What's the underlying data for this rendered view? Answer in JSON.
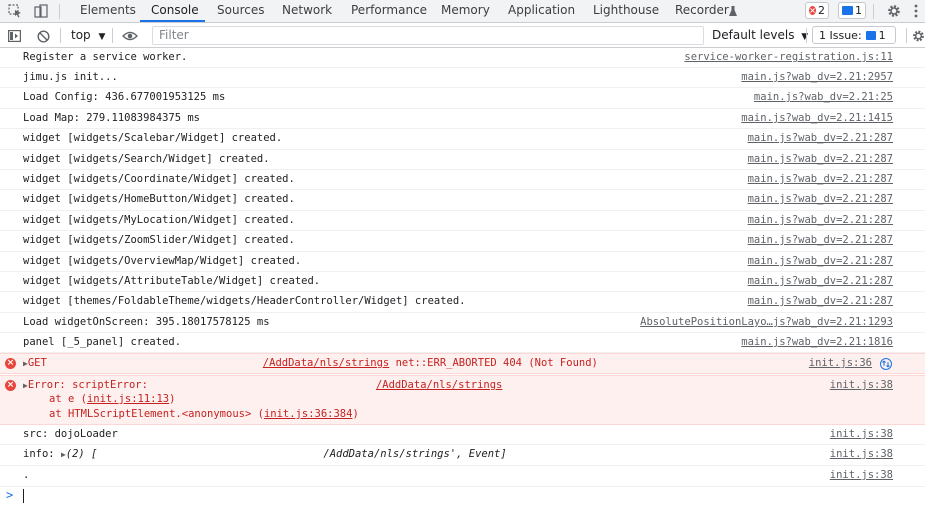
{
  "tabs": [
    {
      "label": "Elements"
    },
    {
      "label": "Console"
    },
    {
      "label": "Sources"
    },
    {
      "label": "Network"
    },
    {
      "label": "Performance"
    },
    {
      "label": "Memory"
    },
    {
      "label": "Application"
    },
    {
      "label": "Lighthouse"
    },
    {
      "label": "Recorder"
    }
  ],
  "badges": {
    "errors": "2",
    "messages": "1"
  },
  "toolbar": {
    "context": "top",
    "filter_placeholder": "Filter",
    "levels": "Default levels",
    "issues": "1 Issue:",
    "issues_count": "1"
  },
  "rows": [
    {
      "msg": "Register a service worker.",
      "src": "service-worker-registration.js:11"
    },
    {
      "msg": "jimu.js init...",
      "src": "main.js?wab_dv=2.21:2957"
    },
    {
      "msg": "Load Config: 436.677001953125 ms",
      "src": "main.js?wab_dv=2.21:25"
    },
    {
      "msg": "Load Map: 279.11083984375 ms",
      "src": "main.js?wab_dv=2.21:1415"
    },
    {
      "msg": "widget [widgets/Scalebar/Widget] created.",
      "src": "main.js?wab_dv=2.21:287"
    },
    {
      "msg": "widget [widgets/Search/Widget] created.",
      "src": "main.js?wab_dv=2.21:287"
    },
    {
      "msg": "widget [widgets/Coordinate/Widget] created.",
      "src": "main.js?wab_dv=2.21:287"
    },
    {
      "msg": "widget [widgets/HomeButton/Widget] created.",
      "src": "main.js?wab_dv=2.21:287"
    },
    {
      "msg": "widget [widgets/MyLocation/Widget] created.",
      "src": "main.js?wab_dv=2.21:287"
    },
    {
      "msg": "widget [widgets/ZoomSlider/Widget] created.",
      "src": "main.js?wab_dv=2.21:287"
    },
    {
      "msg": "widget [widgets/OverviewMap/Widget] created.",
      "src": "main.js?wab_dv=2.21:287"
    },
    {
      "msg": "widget [widgets/AttributeTable/Widget] created.",
      "src": "main.js?wab_dv=2.21:287"
    },
    {
      "msg": "widget [themes/FoldableTheme/widgets/HeaderController/Widget] created.",
      "src": "main.js?wab_dv=2.21:287"
    },
    {
      "msg": "Load widgetOnScreen: 395.18017578125 ms",
      "src": "AbsolutePositionLayo…js?wab_dv=2.21:1293"
    },
    {
      "msg": "panel [_5_panel] created.",
      "src": "main.js?wab_dv=2.21:1816"
    }
  ],
  "error1": {
    "method": "GET",
    "url": "/AddData/nls/strings",
    "status": "net::ERR_ABORTED 404 (Not Found)",
    "src": "init.js:36"
  },
  "error2": {
    "title": "Error: scriptError:",
    "url": "/AddData/nls/strings",
    "line2_prefix": "at e (",
    "line2_link": "init.js:11:13",
    "line2_suffix": ")",
    "line3_prefix": "at HTMLScriptElement.<anonymous> (",
    "line3_link": "init.js:36:384",
    "line3_suffix": ")",
    "src": "init.js:38"
  },
  "after_rows": [
    {
      "msg": "src: dojoLoader",
      "src": "init.js:38"
    },
    {
      "msg_prefix": "info: ",
      "msg_obj": "(2) [",
      "msg_tail": "/AddData/nls/strings', Event]",
      "src": "init.js:38"
    },
    {
      "msg": ".",
      "src": "init.js:38"
    }
  ],
  "prompt_symbol": ">"
}
